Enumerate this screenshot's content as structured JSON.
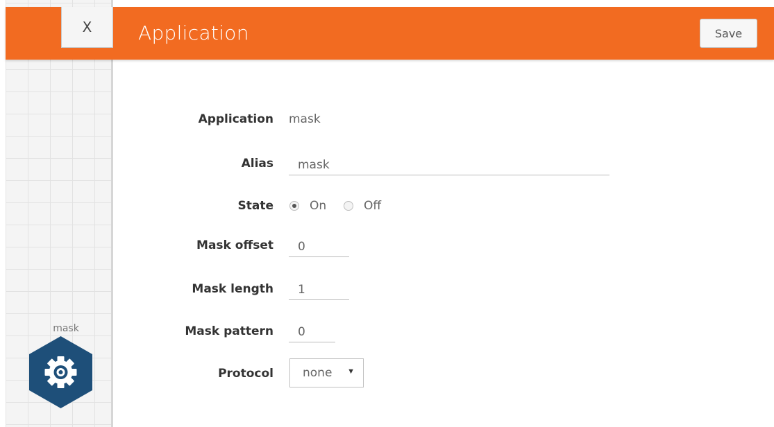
{
  "header": {
    "close_label": "X",
    "title": "Application",
    "save_label": "Save",
    "accent_color": "#f26b21"
  },
  "canvas": {
    "node_label": "mask",
    "node_icon": "gear-icon",
    "node_color": "#1e4f79"
  },
  "form": {
    "application": {
      "label": "Application",
      "value": "mask"
    },
    "alias": {
      "label": "Alias",
      "value": "mask"
    },
    "state": {
      "label": "State",
      "option_on": "On",
      "option_off": "Off",
      "selected": "On"
    },
    "mask_offset": {
      "label": "Mask offset",
      "value": "0"
    },
    "mask_length": {
      "label": "Mask length",
      "value": "1"
    },
    "mask_pattern": {
      "label": "Mask pattern",
      "value": "0"
    },
    "protocol": {
      "label": "Protocol",
      "value": "none",
      "arrow": "▼"
    }
  }
}
